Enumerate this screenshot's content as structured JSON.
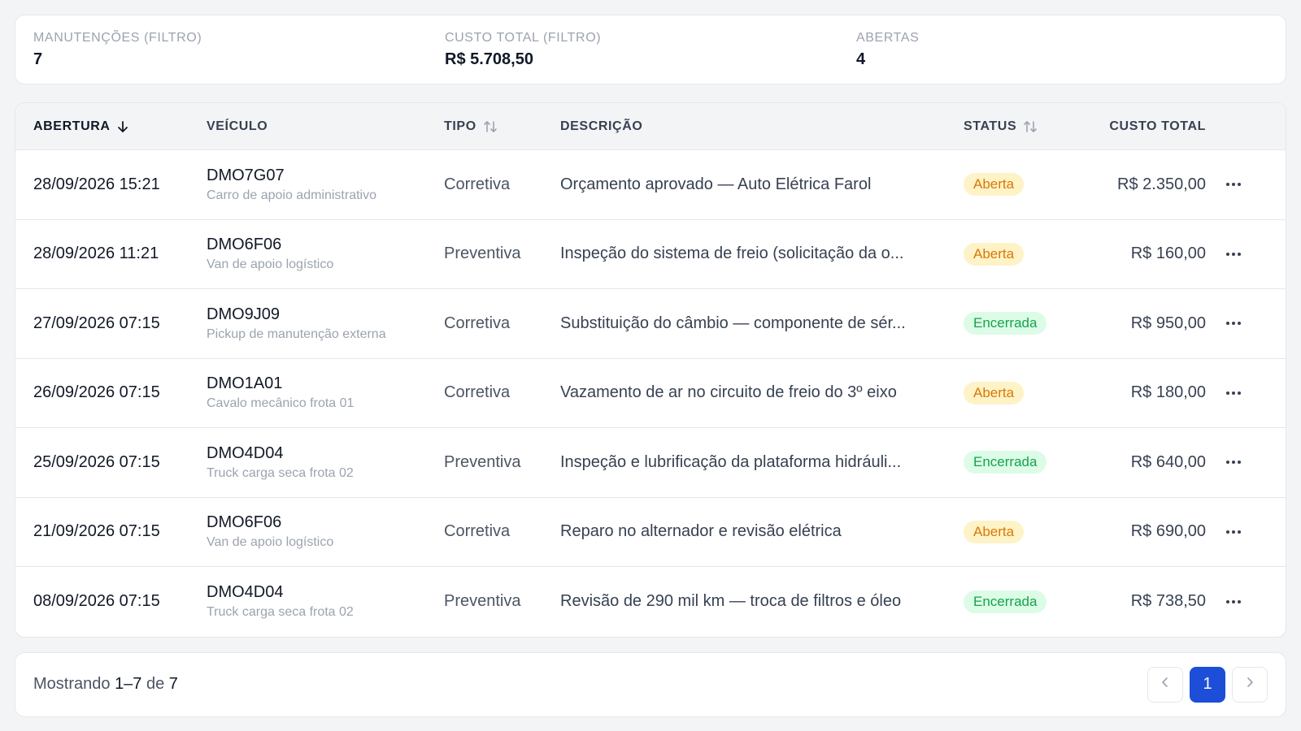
{
  "summary": {
    "stats": [
      {
        "label": "MANUTENÇÕES (FILTRO)",
        "value": "7"
      },
      {
        "label": "CUSTO TOTAL (FILTRO)",
        "value": "R$ 5.708,50"
      },
      {
        "label": "ABERTAS",
        "value": "4"
      }
    ]
  },
  "table": {
    "headers": {
      "date": "ABERTURA",
      "vehicle": "VEÍCULO",
      "type": "TIPO",
      "description": "DESCRIÇÃO",
      "status": "STATUS",
      "cost": "CUSTO TOTAL"
    },
    "sort_icons": {
      "date": "arrow-down-icon",
      "type": "sort-icon",
      "status": "sort-icon"
    },
    "rows": [
      {
        "date": "28/09/2026 15:21",
        "plate": "DMO7G07",
        "vehicle": "Carro de apoio administrativo",
        "type": "Corretiva",
        "description": "Orçamento aprovado — Auto Elétrica Farol",
        "status": "Aberta",
        "cost": "R$ 2.350,00"
      },
      {
        "date": "28/09/2026 11:21",
        "plate": "DMO6F06",
        "vehicle": "Van de apoio logístico",
        "type": "Preventiva",
        "description": "Inspeção do sistema de freio (solicitação da o...",
        "status": "Aberta",
        "cost": "R$ 160,00"
      },
      {
        "date": "27/09/2026 07:15",
        "plate": "DMO9J09",
        "vehicle": "Pickup de manutenção externa",
        "type": "Corretiva",
        "description": "Substituição do câmbio — componente de sér...",
        "status": "Encerrada",
        "cost": "R$ 950,00"
      },
      {
        "date": "26/09/2026 07:15",
        "plate": "DMO1A01",
        "vehicle": "Cavalo mecânico frota 01",
        "type": "Corretiva",
        "description": "Vazamento de ar no circuito de freio do 3º eixo",
        "status": "Aberta",
        "cost": "R$ 180,00"
      },
      {
        "date": "25/09/2026 07:15",
        "plate": "DMO4D04",
        "vehicle": "Truck carga seca frota 02",
        "type": "Preventiva",
        "description": "Inspeção e lubrificação da plataforma hidráuli...",
        "status": "Encerrada",
        "cost": "R$ 640,00"
      },
      {
        "date": "21/09/2026 07:15",
        "plate": "DMO6F06",
        "vehicle": "Van de apoio logístico",
        "type": "Corretiva",
        "description": "Reparo no alternador e revisão elétrica",
        "status": "Aberta",
        "cost": "R$ 690,00"
      },
      {
        "date": "08/09/2026 07:15",
        "plate": "DMO4D04",
        "vehicle": "Truck carga seca frota 02",
        "type": "Preventiva",
        "description": "Revisão de 290 mil km — troca de filtros e óleo",
        "status": "Encerrada",
        "cost": "R$ 738,50"
      }
    ],
    "row_action_icon": "more-horizontal-icon"
  },
  "footer": {
    "prefix": "Mostrando ",
    "range": "1–7",
    "middle": " de ",
    "total": "7",
    "pager": {
      "prev_icon": "chevron-left-icon",
      "current_page": "1",
      "next_icon": "chevron-right-icon"
    }
  },
  "colors": {
    "accent": "#1d4ed8",
    "status_open_bg": "#fef3c7",
    "status_open_fg": "#d97706",
    "status_closed_bg": "#dcfce7",
    "status_closed_fg": "#16a34a"
  }
}
